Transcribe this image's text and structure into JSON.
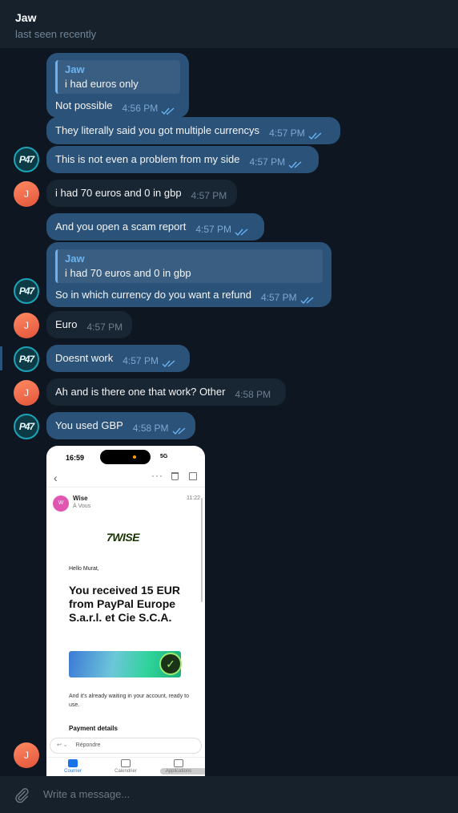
{
  "header": {
    "name": "Jaw",
    "status": "last seen recently"
  },
  "messages": [
    {
      "reply_name": "Jaw",
      "reply_text": "i had euros only",
      "text": "Not possible",
      "time": "4:56 PM"
    },
    {
      "text": "They literally said you got multiple currencys",
      "time": "4:57 PM"
    },
    {
      "text": "This is not even a problem from my side",
      "time": "4:57 PM"
    },
    {
      "text": "i had 70 euros and 0 in gbp",
      "time": "4:57 PM"
    },
    {
      "text": "And you open a scam report",
      "time": "4:57 PM"
    },
    {
      "reply_name": "Jaw",
      "reply_text": "i had 70 euros and 0 in gbp",
      "text": "So in which currency do you want a refund",
      "time": "4:57 PM"
    },
    {
      "text": "Euro",
      "time": "4:57 PM"
    },
    {
      "text": "Doesnt work",
      "time": "4:57 PM"
    },
    {
      "text": "Ah and is there one that work? Other",
      "time": "4:58 PM"
    },
    {
      "text": "You used GBP",
      "time": "4:58 PM"
    }
  ],
  "avatars": {
    "contact_initial": "J",
    "self_logo": "P47"
  },
  "screenshot": {
    "status_time": "16:59",
    "signal": "5G",
    "sender": "Wise",
    "sender_initial": "W",
    "to": "À Vous",
    "mail_time": "11:22",
    "logo": "7WISE",
    "greeting": "Hello Murat,",
    "headline": "You received 15 EUR from PayPal Europe S.a.r.l. et Cie S.C.A.",
    "body": "And it's already waiting in your account, ready to use.",
    "section": "Payment details",
    "reply_label": "Répondre",
    "tabs": [
      "Courrier",
      "Calendrier",
      "Applications"
    ]
  },
  "composer": {
    "placeholder": "Write a message..."
  },
  "colors": {
    "outgoing": "#2b5278",
    "incoming": "#182533",
    "background": "#0e1621",
    "accent": "#6ab3f3"
  }
}
